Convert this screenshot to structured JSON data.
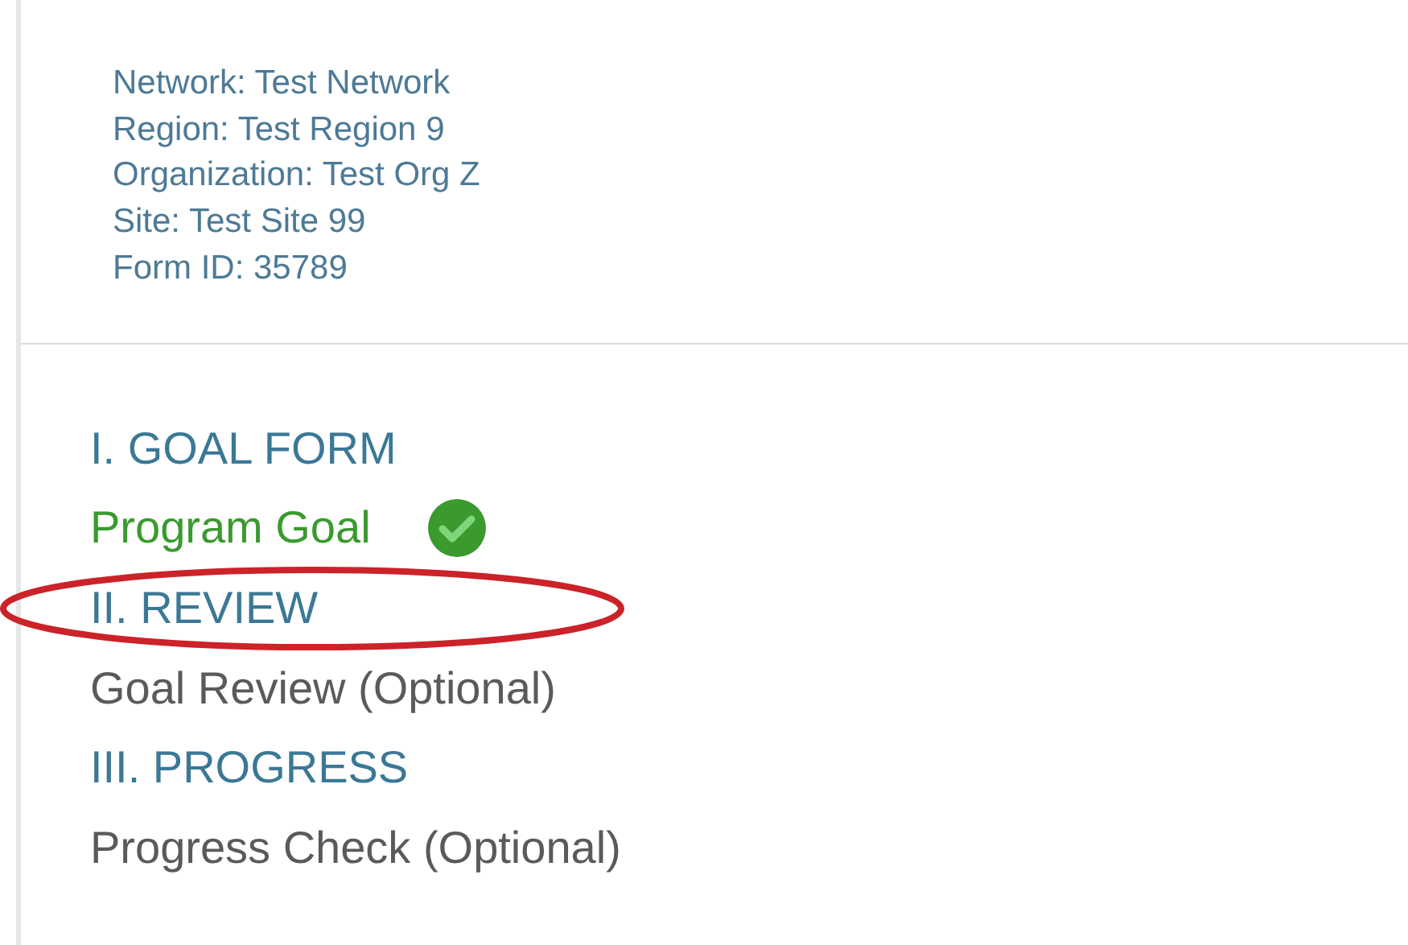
{
  "info_lines": [
    "Network: Test Network",
    "Region: Test Region 9",
    "Organization: Test Org Z",
    "Site: Test Site 99",
    "Form ID: 35789"
  ],
  "nav_items": [
    {
      "kind": "section",
      "label": "I. GOAL FORM",
      "completed": false,
      "circled": false
    },
    {
      "kind": "form",
      "label": "Program Goal",
      "completed": true,
      "circled": false
    },
    {
      "kind": "section",
      "label": "II. REVIEW",
      "completed": false,
      "circled": true
    },
    {
      "kind": "form",
      "label": "Goal Review (Optional)",
      "completed": false,
      "circled": false
    },
    {
      "kind": "section",
      "label": "III. PROGRESS",
      "completed": false,
      "circled": false
    },
    {
      "kind": "form",
      "label": "Progress Check (Optional)",
      "completed": false,
      "circled": false
    }
  ]
}
